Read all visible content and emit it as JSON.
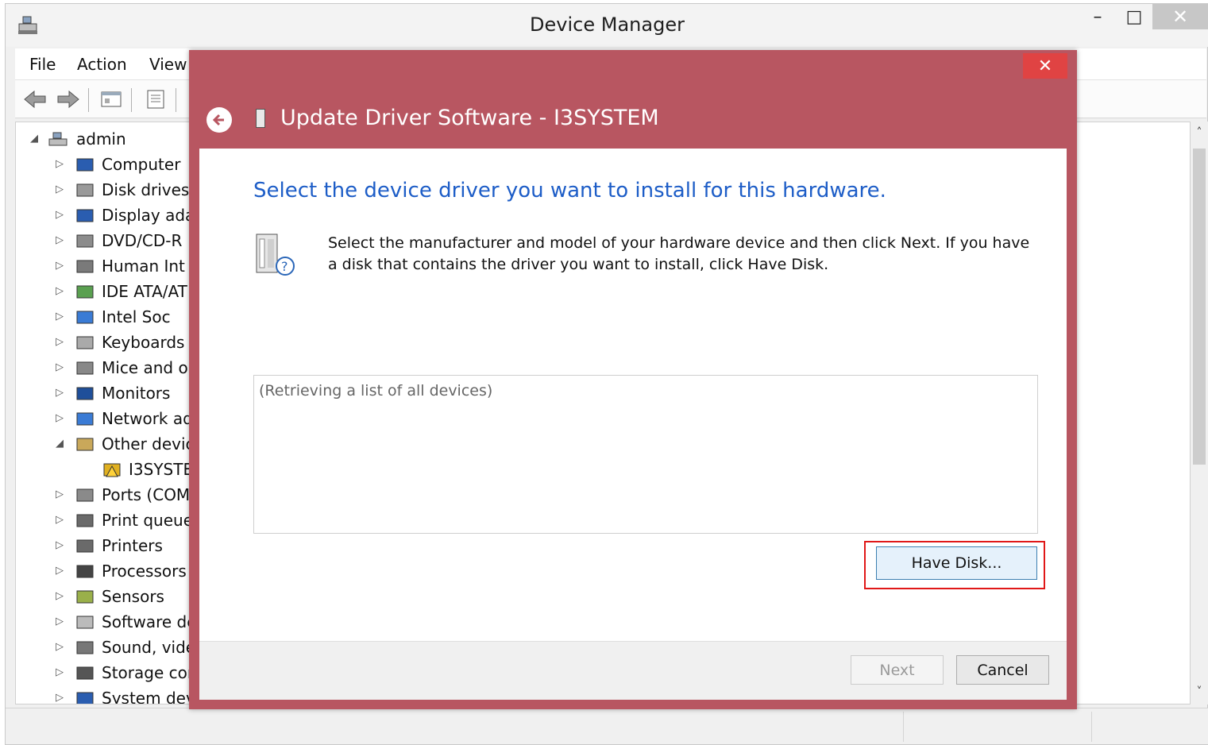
{
  "window": {
    "title": "Device Manager",
    "minimize_glyph": "–",
    "maximize_glyph": "□",
    "close_glyph": "✕"
  },
  "menu": [
    "File",
    "Action",
    "View"
  ],
  "tree": {
    "root": "admin",
    "items": [
      {
        "label": "Computer",
        "icon": "computer-icon",
        "expander": "▷"
      },
      {
        "label": "Disk drives",
        "icon": "disk-drive-icon",
        "expander": "▷"
      },
      {
        "label": "Display ada",
        "icon": "display-adapter-icon",
        "expander": "▷"
      },
      {
        "label": "DVD/CD-R",
        "icon": "dvd-drive-icon",
        "expander": "▷"
      },
      {
        "label": "Human Int",
        "icon": "hid-icon",
        "expander": "▷"
      },
      {
        "label": "IDE ATA/AT",
        "icon": "ide-controller-icon",
        "expander": "▷"
      },
      {
        "label": "Intel Soc",
        "icon": "network-icon",
        "expander": "▷"
      },
      {
        "label": "Keyboards",
        "icon": "keyboard-icon",
        "expander": "▷"
      },
      {
        "label": "Mice and o",
        "icon": "mouse-icon",
        "expander": "▷"
      },
      {
        "label": "Monitors",
        "icon": "monitor-icon",
        "expander": "▷"
      },
      {
        "label": "Network ad",
        "icon": "network-adapter-icon",
        "expander": "▷"
      },
      {
        "label": "Other devic",
        "icon": "other-devices-icon",
        "expander": "◢"
      },
      {
        "label": "I3SYSTE",
        "icon": "warning-device-icon",
        "expander": ""
      },
      {
        "label": "Ports (COM",
        "icon": "ports-icon",
        "expander": "▷"
      },
      {
        "label": "Print queue",
        "icon": "printer-icon",
        "expander": "▷"
      },
      {
        "label": "Printers",
        "icon": "printer-icon",
        "expander": "▷"
      },
      {
        "label": "Processors",
        "icon": "processor-icon",
        "expander": "▷"
      },
      {
        "label": "Sensors",
        "icon": "sensor-icon",
        "expander": "▷"
      },
      {
        "label": "Software de",
        "icon": "software-device-icon",
        "expander": "▷"
      },
      {
        "label": "Sound, vide",
        "icon": "speaker-icon",
        "expander": "▷"
      },
      {
        "label": "Storage cor",
        "icon": "storage-icon",
        "expander": "▷"
      },
      {
        "label": "System dev",
        "icon": "system-device-icon",
        "expander": "▷"
      }
    ]
  },
  "dialog": {
    "title": "Update Driver Software - I3SYSTEM",
    "close_glyph": "✕",
    "heading": "Select the device driver you want to install for this hardware.",
    "description": "Select the manufacturer and model of your hardware device and then click Next. If you have a disk that contains the driver you want to install, click Have Disk.",
    "list_status": "(Retrieving a list of all devices)",
    "have_disk_label": "Have Disk...",
    "next_label": "Next",
    "cancel_label": "Cancel"
  },
  "scrollbar": {
    "up_glyph": "˄",
    "down_glyph": "˅"
  }
}
